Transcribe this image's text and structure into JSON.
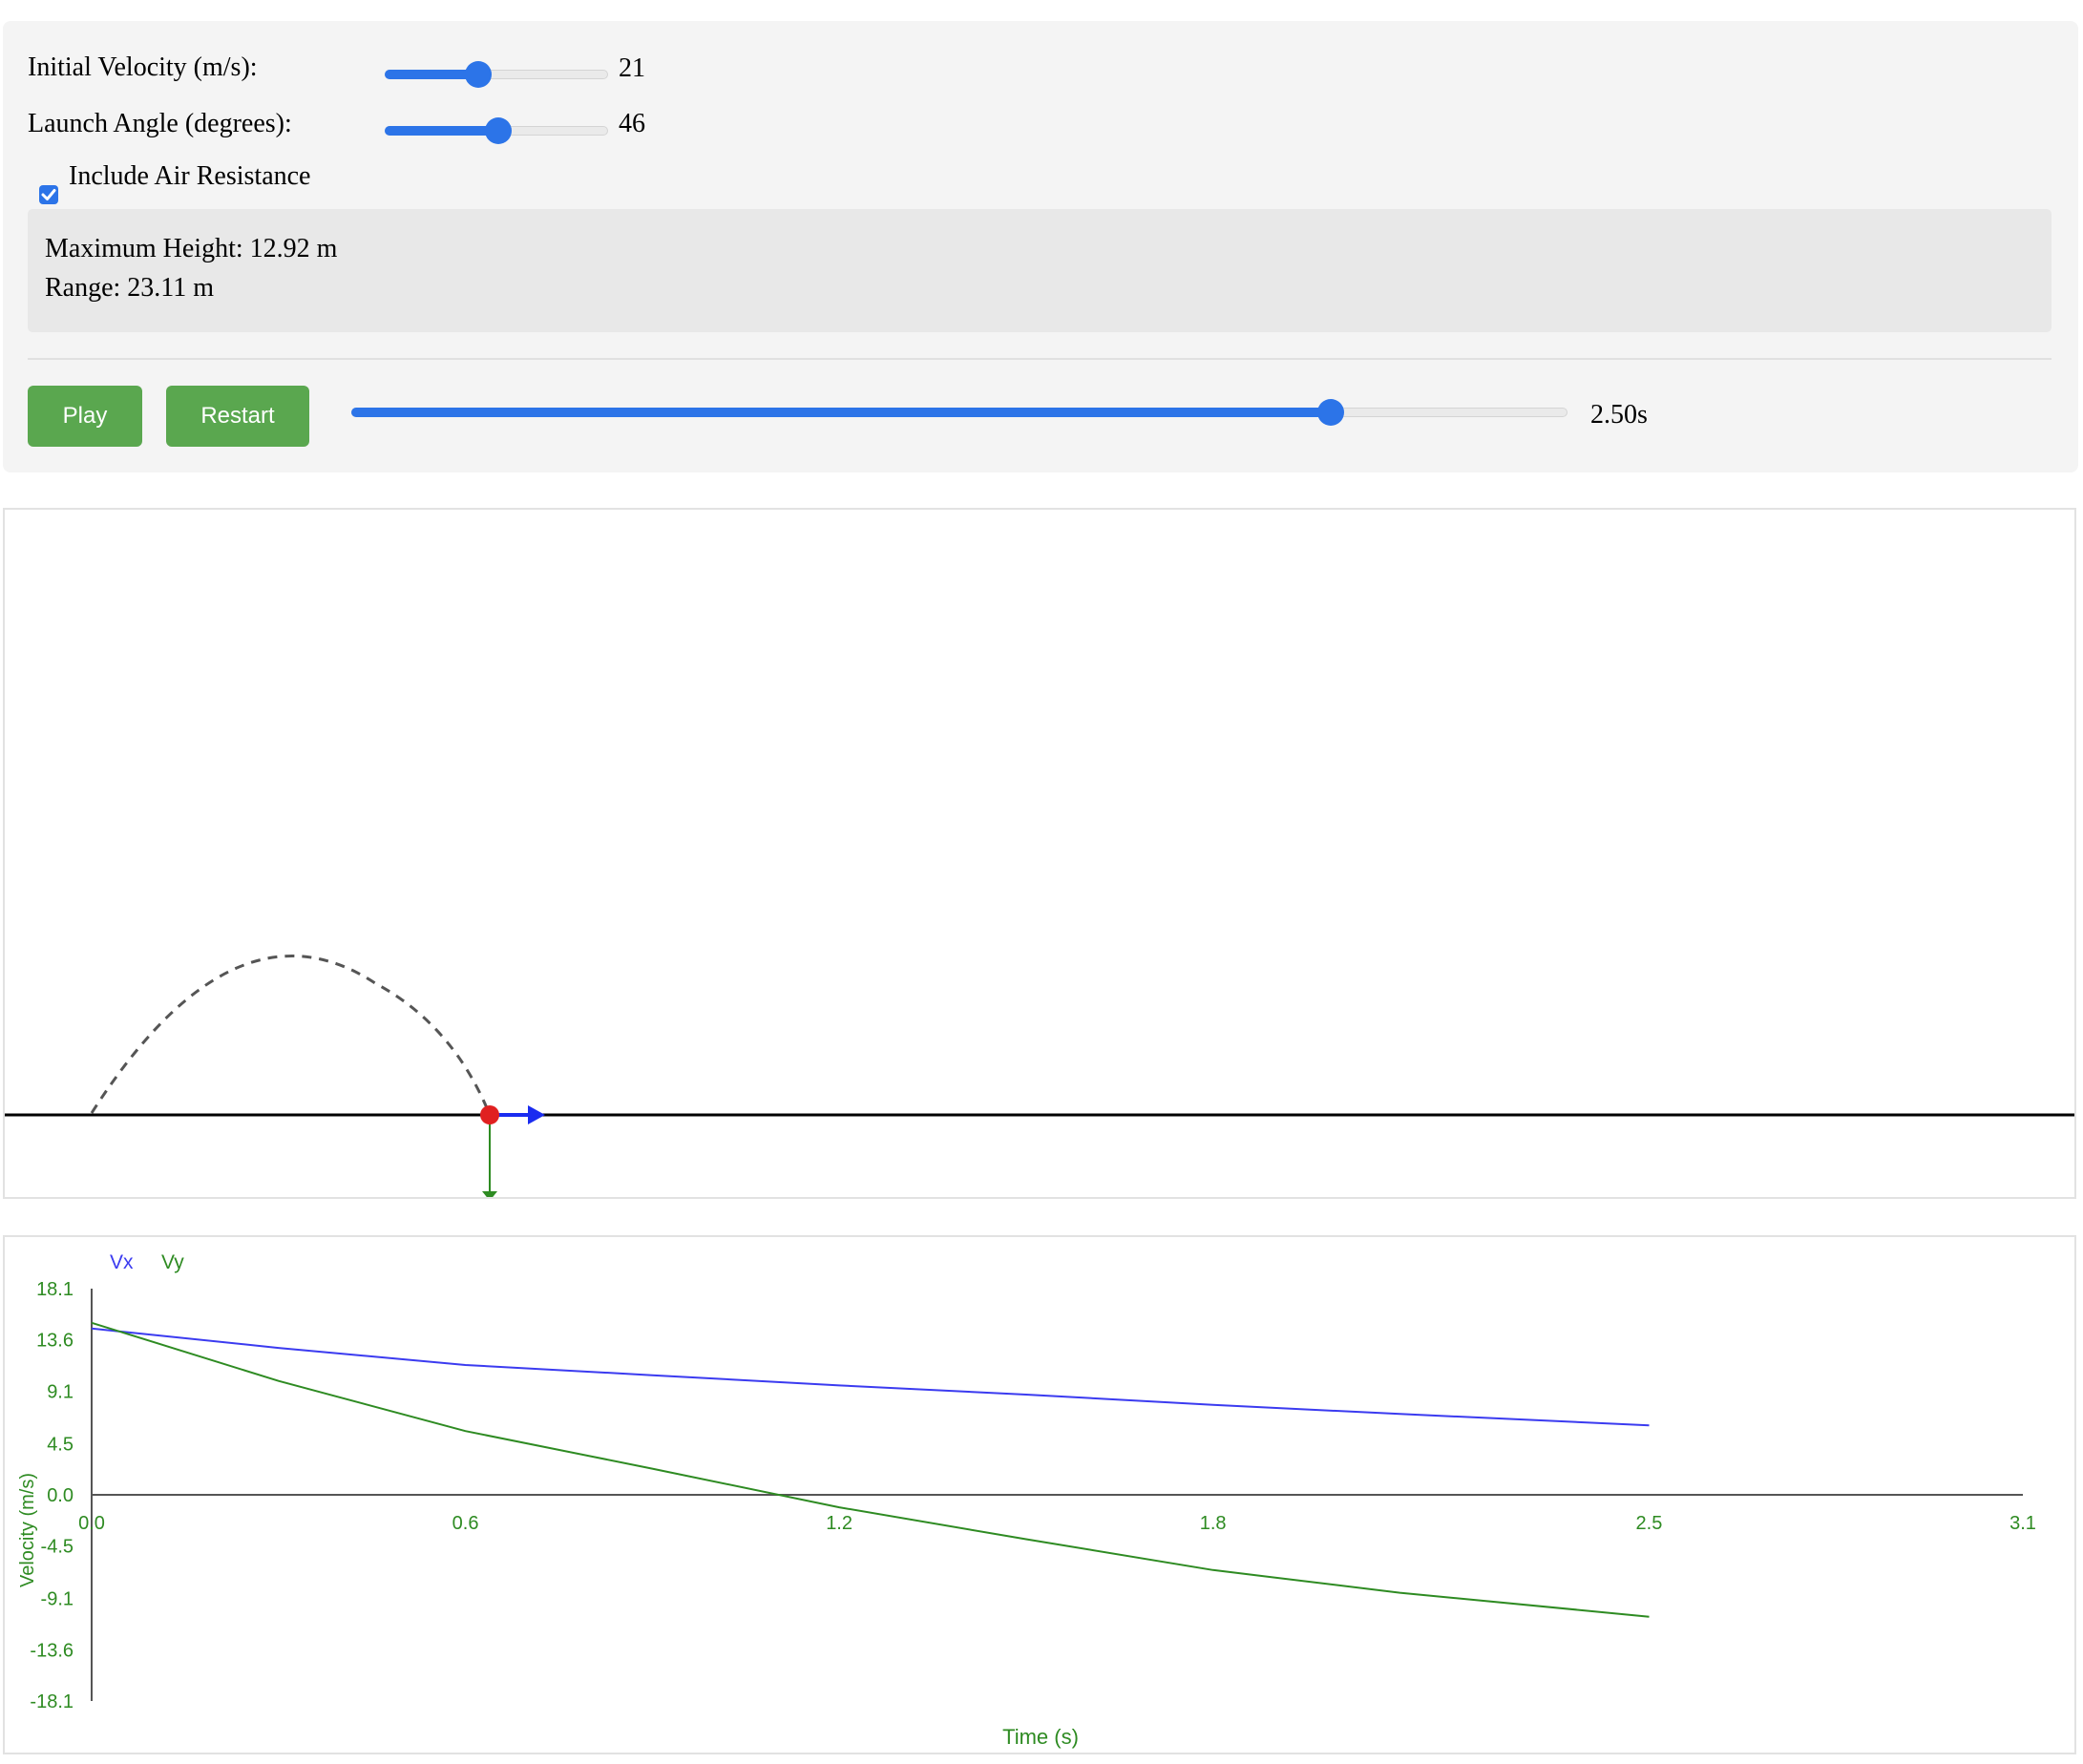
{
  "controls": {
    "velocity": {
      "label": "Initial Velocity (m/s):",
      "value": "21",
      "fraction": 0.42
    },
    "angle": {
      "label": "Launch Angle (degrees):",
      "value": "46",
      "fraction": 0.51
    },
    "air_resistance": {
      "label": "Include Air Resistance",
      "checked": true
    }
  },
  "results": {
    "max_height": "Maximum Height: 12.92 m",
    "range": "Range: 23.11 m"
  },
  "playback": {
    "play_label": "Play",
    "restart_label": "Restart",
    "time_label": "2.50s",
    "fraction": 0.805
  },
  "colors": {
    "accent": "#2c74e8",
    "button": "#5aa74f",
    "vx": "#3b3bf0",
    "vy": "#2e8b22",
    "ball": "#e02020"
  },
  "chart_data": {
    "type": "line",
    "title": "",
    "xlabel": "Time (s)",
    "ylabel": "Velocity (m/s)",
    "xlim": [
      0,
      3.1
    ],
    "ylim": [
      -18.1,
      18.1
    ],
    "x_ticks": [
      "0.0",
      "0.6",
      "1.2",
      "1.8",
      "2.5",
      "3.1"
    ],
    "y_ticks": [
      "18.1",
      "13.6",
      "9.1",
      "4.5",
      "0.0",
      "-4.5",
      "-9.1",
      "-13.6",
      "-18.1"
    ],
    "legend": [
      "Vx",
      "Vy"
    ],
    "series": [
      {
        "name": "Vx",
        "x": [
          0,
          0.3,
          0.6,
          0.9,
          1.2,
          1.5,
          1.8,
          2.1,
          2.5
        ],
        "values": [
          14.6,
          12.9,
          11.4,
          10.5,
          9.6,
          8.8,
          7.9,
          7.1,
          6.1
        ]
      },
      {
        "name": "Vy",
        "x": [
          0,
          0.3,
          0.6,
          0.9,
          1.2,
          1.5,
          1.8,
          2.1,
          2.5
        ],
        "values": [
          15.1,
          10.0,
          5.6,
          2.3,
          -1.1,
          -3.9,
          -6.6,
          -8.6,
          -10.7
        ]
      }
    ]
  }
}
